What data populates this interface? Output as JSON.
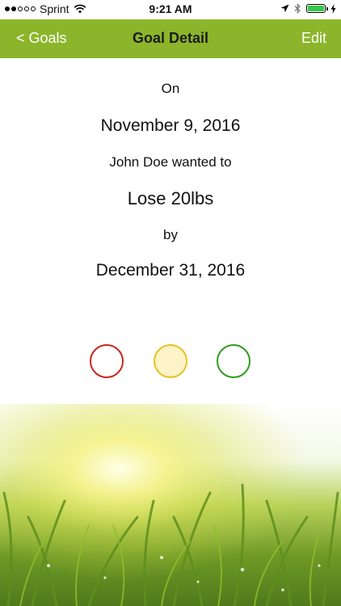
{
  "status_bar": {
    "carrier": "Sprint",
    "time": "9:21 AM",
    "signal_bars_filled": 2,
    "signal_bars_total": 5,
    "battery_level": 1.0,
    "icons": [
      "wifi-icon",
      "location-arrow-icon",
      "bluetooth-icon",
      "battery-icon",
      "charging-bolt-icon"
    ]
  },
  "nav": {
    "back_label": "< Goals",
    "title": "Goal Detail",
    "edit_label": "Edit",
    "background_color": "#8cb52b"
  },
  "goal": {
    "on_label": "On",
    "created_date": "November 9, 2016",
    "user_statement": "John Doe wanted to",
    "goal_text": "Lose 20lbs",
    "by_label": "by",
    "target_date": "December 31, 2016"
  },
  "status_indicators": [
    {
      "name": "red-status-indicator",
      "border_color": "#c9261c",
      "fill_color": "#ffffff"
    },
    {
      "name": "yellow-status-indicator",
      "border_color": "#e6c21f",
      "fill_color": "#fdf3c8"
    },
    {
      "name": "green-status-indicator",
      "border_color": "#2f9b1f",
      "fill_color": "#ffffff"
    }
  ],
  "background_image": "grass-sunlight-photo"
}
